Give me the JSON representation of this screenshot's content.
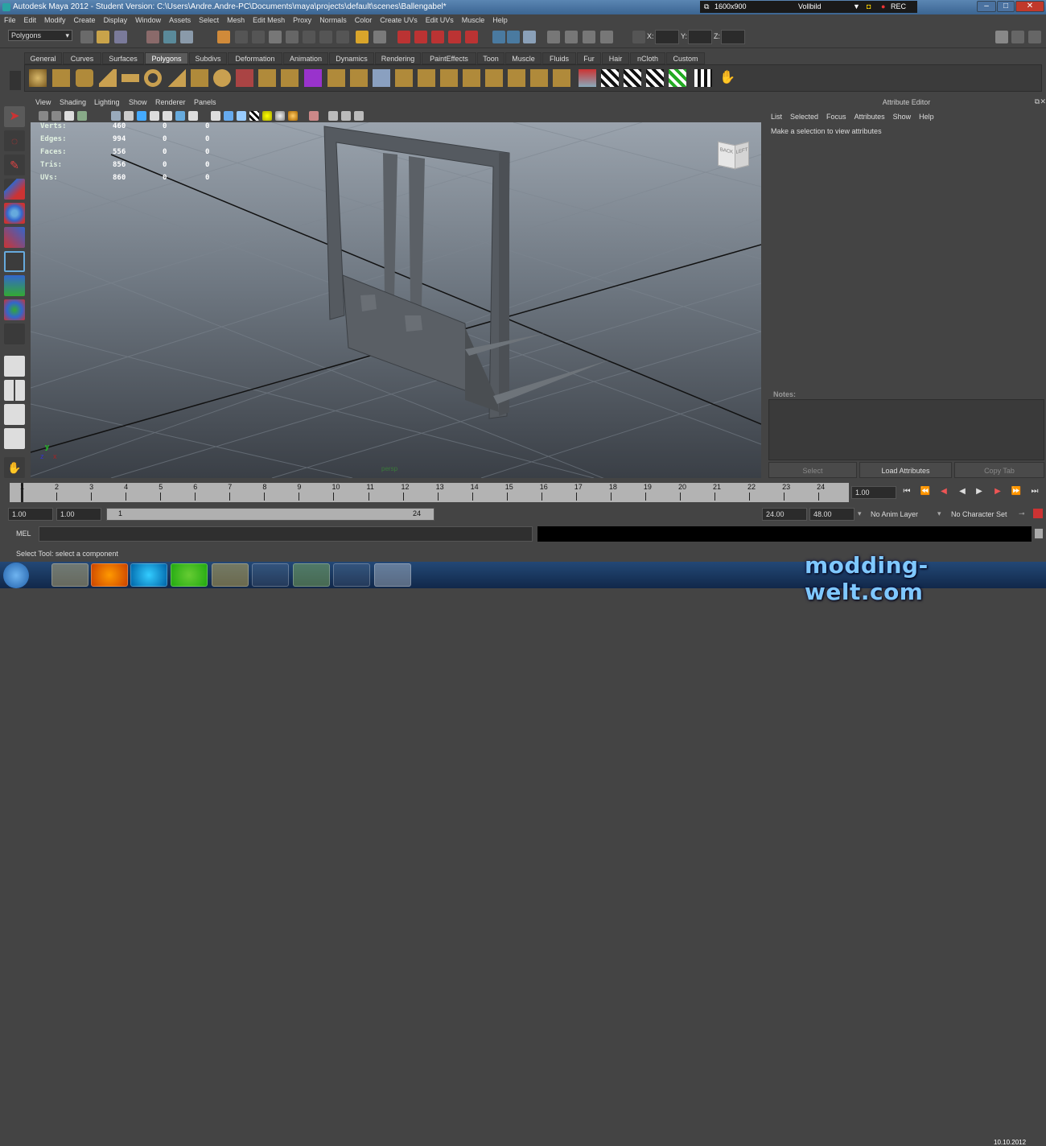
{
  "window": {
    "title": "Autodesk Maya 2012 - Student Version: C:\\Users\\Andre.Andre-PC\\Documents\\maya\\projects\\default\\scenes\\Ballengabel*",
    "resolution": "1600x900",
    "capture_mode": "Vollbild",
    "rec_label": "REC"
  },
  "menu": [
    "File",
    "Edit",
    "Modify",
    "Create",
    "Display",
    "Window",
    "Assets",
    "Select",
    "Mesh",
    "Edit Mesh",
    "Proxy",
    "Normals",
    "Color",
    "Create UVs",
    "Edit UVs",
    "Muscle",
    "Help"
  ],
  "status_line": {
    "mode": "Polygons",
    "x_label": "X:",
    "y_label": "Y:",
    "z_label": "Z:"
  },
  "shelf_tabs": [
    "General",
    "Curves",
    "Surfaces",
    "Polygons",
    "Subdivs",
    "Deformation",
    "Animation",
    "Dynamics",
    "Rendering",
    "PaintEffects",
    "Toon",
    "Muscle",
    "Fluids",
    "Fur",
    "Hair",
    "nCloth",
    "Custom"
  ],
  "active_shelf_tab": "Polygons",
  "viewport": {
    "menu": [
      "View",
      "Shading",
      "Lighting",
      "Show",
      "Renderer",
      "Panels"
    ],
    "hud": [
      {
        "label": "Verts:",
        "v1": "460",
        "v2": "0",
        "v3": "0"
      },
      {
        "label": "Edges:",
        "v1": "994",
        "v2": "0",
        "v3": "0"
      },
      {
        "label": "Faces:",
        "v1": "556",
        "v2": "0",
        "v3": "0"
      },
      {
        "label": "Tris:",
        "v1": "856",
        "v2": "0",
        "v3": "0"
      },
      {
        "label": "UVs:",
        "v1": "860",
        "v2": "0",
        "v3": "0"
      }
    ],
    "viewcube_front": "BACK",
    "viewcube_side": "LEFT",
    "axis_x": "x",
    "axis_y": "y",
    "axis_z": "z",
    "camera_label": "persp"
  },
  "attribute_editor": {
    "title": "Attribute Editor",
    "menu": [
      "List",
      "Selected",
      "Focus",
      "Attributes",
      "Show",
      "Help"
    ],
    "message": "Make a selection to view attributes",
    "notes_label": "Notes:",
    "buttons": [
      "Select",
      "Load Attributes",
      "Copy Tab"
    ]
  },
  "timeline": {
    "ticks": [
      "1",
      "2",
      "3",
      "4",
      "5",
      "6",
      "7",
      "8",
      "9",
      "10",
      "11",
      "12",
      "13",
      "14",
      "15",
      "16",
      "17",
      "18",
      "19",
      "20",
      "21",
      "22",
      "23",
      "24"
    ],
    "current_frame": "1.00"
  },
  "range": {
    "start": "1.00",
    "playback_start": "1.00",
    "range_start_label": "1",
    "range_end_label": "24",
    "playback_end": "24.00",
    "end": "48.00",
    "anim_layer": "No Anim Layer",
    "character_set": "No Character Set"
  },
  "command_line": {
    "label": "MEL"
  },
  "help_line": "Select Tool: select a component",
  "taskbar": {
    "date": "10.10.2012"
  },
  "watermark": "modding-welt.com",
  "colors": {
    "maya_gray": "#444444",
    "active_tab": "#5a5a5a",
    "timeline": "#b3b3b3",
    "taskbar": "#1b3a63",
    "title_blue": "#4a76a4",
    "highlight_red": "#c0392b"
  }
}
